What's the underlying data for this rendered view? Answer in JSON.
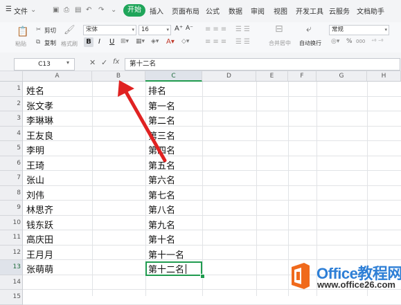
{
  "menu": {
    "file": "文件",
    "start": "开始",
    "tabs": [
      "插入",
      "页面布局",
      "公式",
      "数据",
      "审阅",
      "视图",
      "开发工具",
      "云服务",
      "文档助手"
    ]
  },
  "ribbon": {
    "paste": "粘贴",
    "cut": "剪切",
    "copy": "复制",
    "format_painter": "格式刷",
    "font_name": "宋体",
    "font_size": "16",
    "merge_center": "合并居中",
    "wrap_text": "自动换行",
    "number_format": "常规",
    "bold": "B",
    "italic": "I",
    "underline": "U",
    "percent": "%",
    "thousands": "000"
  },
  "formula_bar": {
    "name_box": "C13",
    "fx": "fx",
    "content": "第十二名"
  },
  "columns": [
    "A",
    "B",
    "C",
    "D",
    "E",
    "F",
    "G",
    "H"
  ],
  "rows": [
    {
      "num": "1",
      "a": "姓名",
      "c": "排名"
    },
    {
      "num": "2",
      "a": "张文孝",
      "c": "第一名"
    },
    {
      "num": "3",
      "a": "李琳琳",
      "c": "第二名"
    },
    {
      "num": "4",
      "a": "王友良",
      "c": "第三名"
    },
    {
      "num": "5",
      "a": "李明",
      "c": "第四名"
    },
    {
      "num": "6",
      "a": "王琦",
      "c": "第五名"
    },
    {
      "num": "7",
      "a": "张山",
      "c": "第六名"
    },
    {
      "num": "8",
      "a": "刘伟",
      "c": "第七名"
    },
    {
      "num": "9",
      "a": "林思齐",
      "c": "第八名"
    },
    {
      "num": "10",
      "a": "钱东跃",
      "c": "第九名"
    },
    {
      "num": "11",
      "a": "高庆田",
      "c": "第十名"
    },
    {
      "num": "12",
      "a": "王月月",
      "c": "第十一名"
    },
    {
      "num": "13",
      "a": "张萌萌",
      "c": "第十二名"
    },
    {
      "num": "14",
      "a": "",
      "c": ""
    },
    {
      "num": "15",
      "a": "",
      "c": ""
    }
  ],
  "watermark": {
    "brand": "Office教程网",
    "url": "www.office26.com"
  },
  "colors": {
    "accent_green": "#1fa55a",
    "annotation_arrow": "#e02222",
    "watermark_orange": "#f06a1c",
    "watermark_blue": "#2e7fd6"
  }
}
